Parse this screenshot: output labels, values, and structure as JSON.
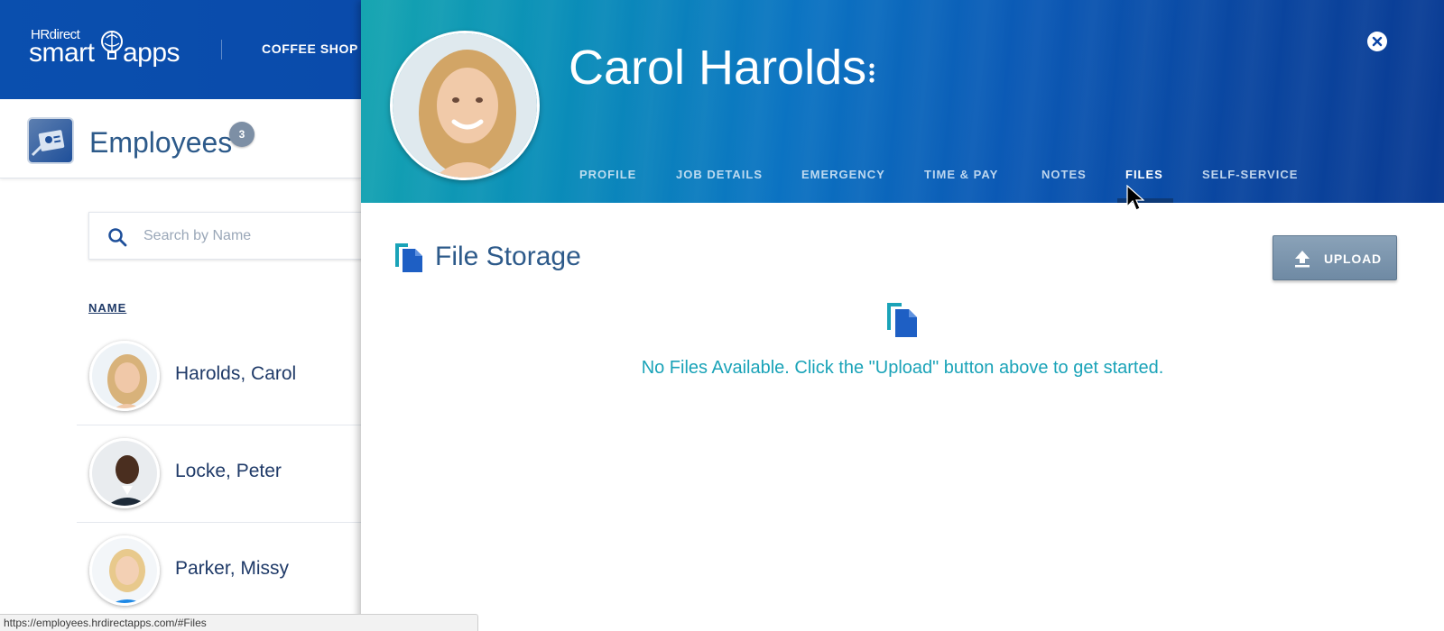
{
  "app": {
    "logo_hr": "HRdirect",
    "logo_smart": "smart",
    "logo_apps": "apps",
    "company_name": "COFFEE SHOP C"
  },
  "employees_header": {
    "title": "Employees",
    "count": "3"
  },
  "search": {
    "placeholder": "Search by Name",
    "value": ""
  },
  "table": {
    "name_column_header": "NAME"
  },
  "employees": [
    {
      "name": "Harolds, Carol"
    },
    {
      "name": "Locke, Peter"
    },
    {
      "name": "Parker, Missy"
    }
  ],
  "status_bar": {
    "url": "https://employees.hrdirectapps.com/#Files"
  },
  "detail": {
    "employee_name": "Carol Harolds",
    "tabs": [
      {
        "label": "PROFILE"
      },
      {
        "label": "JOB DETAILS"
      },
      {
        "label": "EMERGENCY"
      },
      {
        "label": "TIME & PAY"
      },
      {
        "label": "NOTES"
      },
      {
        "label": "FILES",
        "active": true
      },
      {
        "label": "SELF-SERVICE"
      }
    ],
    "section_title": "File Storage",
    "upload_label": "UPLOAD",
    "empty_message": "No Files Available. Click the \"Upload\" button above to get started."
  },
  "icons": {
    "search": "search-icon",
    "close": "close-icon",
    "more": "more-vertical-icon",
    "files": "file-copy-icon",
    "upload": "upload-icon"
  },
  "colors": {
    "primary_blue": "#0b45a6",
    "header_teal": "#15a5b0",
    "text_navy": "#1f3a68",
    "empty_message_teal": "#1aa3b8",
    "upload_button": "#7a93ab"
  }
}
